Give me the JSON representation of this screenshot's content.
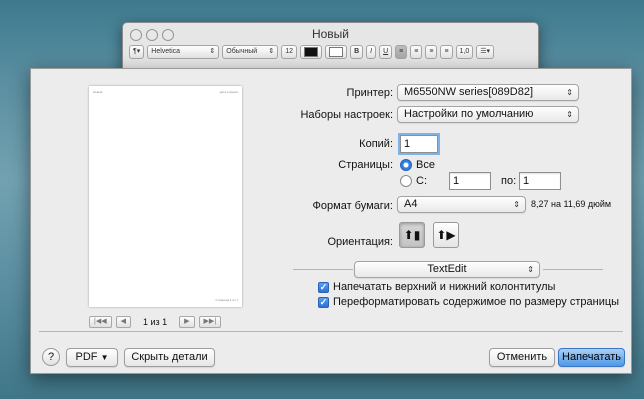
{
  "window": {
    "title": "Новый"
  },
  "toolbar": {
    "paragraph": "¶▾",
    "font_family": "Helvetica",
    "font_style": "Обычный",
    "font_size": "12",
    "bold": "B",
    "italic": "I",
    "underline": "U",
    "spacing": "1,0",
    "list": "☰▾"
  },
  "preview": {
    "header_left": "Новый",
    "header_right": "дата и время",
    "footer": "Страница 1 из 1",
    "page_indicator": "1 из 1",
    "first": "|◀◀",
    "prev": "◀",
    "next": "▶",
    "last": "▶▶|"
  },
  "printer": {
    "label": "Принтер:",
    "value": "M6550NW series[089D82]"
  },
  "presets": {
    "label": "Наборы настроек:",
    "value": "Настройки по умолчанию"
  },
  "copies": {
    "label": "Копий:",
    "value": "1"
  },
  "pages": {
    "label": "Страницы:",
    "all": "Все",
    "from_label": "С:",
    "from_value": "1",
    "to_label": "по:",
    "to_value": "1"
  },
  "paper": {
    "label": "Формат бумаги:",
    "value": "A4",
    "size_text": "8,27 на 11,69 дюйм"
  },
  "orientation": {
    "label": "Ориентация:"
  },
  "app_section": {
    "value": "TextEdit"
  },
  "options": {
    "print_headers": "Напечатать верхний и нижний колонтитулы",
    "rewrap": "Переформатировать содержимое по размеру страницы"
  },
  "footer": {
    "help": "?",
    "pdf": "PDF",
    "hide_details": "Скрыть детали",
    "cancel": "Отменить",
    "print": "Напечатать"
  }
}
